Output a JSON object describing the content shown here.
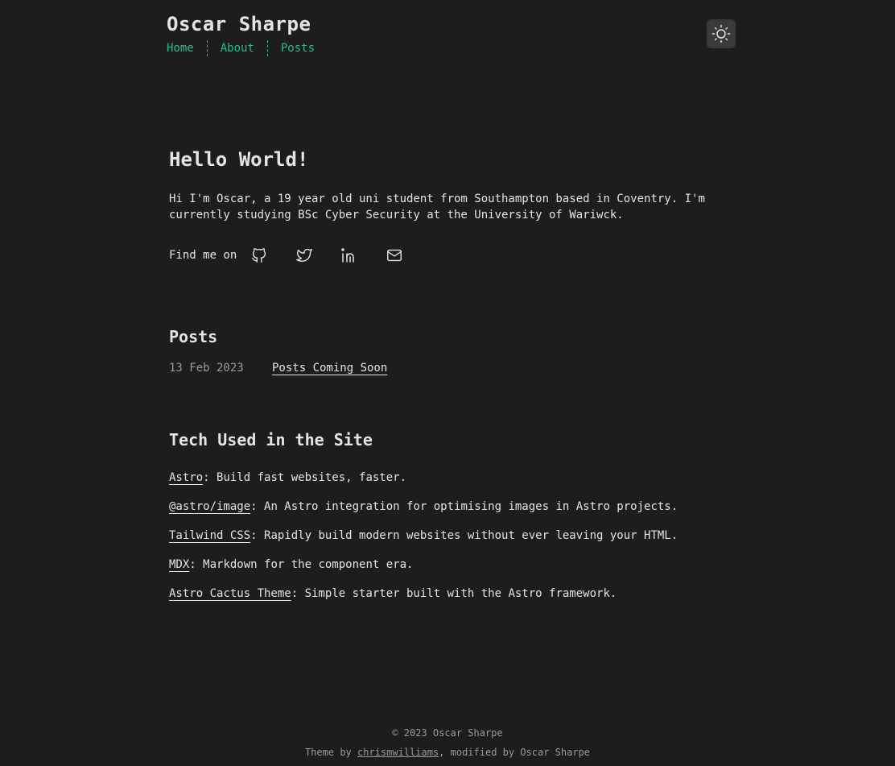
{
  "site": {
    "title": "Oscar Sharpe"
  },
  "nav": [
    {
      "label": "Home"
    },
    {
      "label": "About"
    },
    {
      "label": "Posts"
    }
  ],
  "theme_toggle": {
    "icon": "sun-icon"
  },
  "hero": {
    "heading": "Hello World!",
    "intro": "Hi I'm Oscar, a 19 year old uni student from Southampton based in Coventry. I'm currently studying BSc Cyber Security at the University of Wariwck.",
    "find_me_label": "Find me on",
    "social": [
      "github-icon",
      "twitter-icon",
      "linkedin-icon",
      "mail-icon"
    ]
  },
  "posts": {
    "heading": "Posts",
    "items": [
      {
        "date": "13 Feb 2023",
        "title": "Posts Coming Soon"
      }
    ]
  },
  "tech": {
    "heading": "Tech Used in the Site",
    "items": [
      {
        "name": "Astro",
        "desc": ": Build fast websites, faster."
      },
      {
        "name": "@astro/image",
        "desc": ": An Astro integration for optimising images in Astro projects."
      },
      {
        "name": "Tailwind CSS",
        "desc": ": Rapidly build modern websites without ever leaving your HTML."
      },
      {
        "name": "MDX",
        "desc": ": Markdown for the component era."
      },
      {
        "name": "Astro Cactus Theme",
        "desc": ": Simple starter built with the Astro framework."
      }
    ]
  },
  "footer": {
    "copyright": "© 2023 Oscar Sharpe",
    "theme_prefix": "Theme by ",
    "theme_author": "chrismwilliams",
    "theme_suffix": ", modified by Oscar Sharpe"
  },
  "colors": {
    "accent": "#2bbc8a",
    "background": "#1d1d1d",
    "text": "#e4e4e4"
  }
}
